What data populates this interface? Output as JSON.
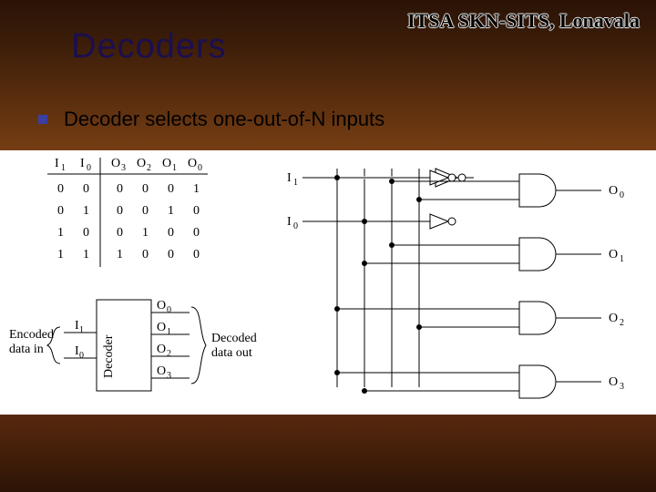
{
  "org_label": "ITSA SKN-SITS, Lonavala",
  "title": "Decoders",
  "bullet": "Decoder selects one-out-of-N inputs",
  "truth_table": {
    "headers": [
      "I₁",
      "I₀",
      "O₃",
      "O₂",
      "O₁",
      "O₀"
    ],
    "rows": [
      [
        "0",
        "0",
        "0",
        "0",
        "0",
        "1"
      ],
      [
        "0",
        "1",
        "0",
        "0",
        "1",
        "0"
      ],
      [
        "1",
        "0",
        "0",
        "1",
        "0",
        "0"
      ],
      [
        "1",
        "1",
        "1",
        "0",
        "0",
        "0"
      ]
    ]
  },
  "block": {
    "left_label_line1": "Encoded",
    "left_label_line2": "data in",
    "in_labels": [
      "I₁",
      "I₀"
    ],
    "body_label": "Decoder",
    "out_labels": [
      "O₀",
      "O₁",
      "O₂",
      "O₃"
    ],
    "right_label_line1": "Decoded",
    "right_label_line2": "data out"
  },
  "circuit": {
    "inputs": [
      "I₁",
      "I₀"
    ],
    "outputs": [
      "O₀",
      "O₁",
      "O₂",
      "O₃"
    ]
  }
}
